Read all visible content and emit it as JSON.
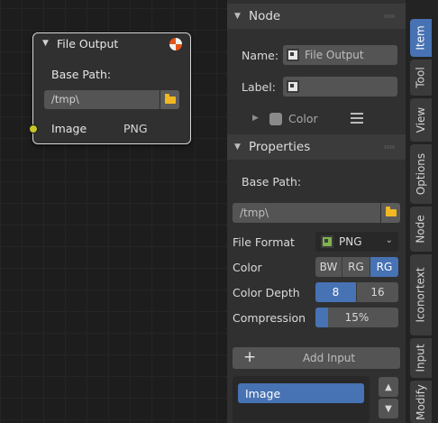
{
  "node": {
    "title": "File Output",
    "base_path_label": "Base Path:",
    "base_path_value": "/tmp\\",
    "input_label": "Image",
    "input_format": "PNG"
  },
  "sidebar": {
    "node_panel": {
      "title": "Node",
      "name_label": "Name:",
      "name_value": "File Output",
      "label_label": "Label:",
      "label_value": "",
      "color_label": "Color"
    },
    "properties_panel": {
      "title": "Properties",
      "base_path_label": "Base Path:",
      "base_path_value": "/tmp\\",
      "file_format_label": "File Format",
      "file_format_value": "PNG",
      "color_label": "Color",
      "color_options": [
        "BW",
        "RG",
        "RG"
      ],
      "color_selected_index": 2,
      "color_depth_label": "Color Depth",
      "color_depth_options": [
        "8",
        "16"
      ],
      "color_depth_selected_index": 0,
      "compression_label": "Compression",
      "compression_value": "15%",
      "compression_fraction": 0.15,
      "add_input_label": "Add Input",
      "inputs": [
        "Image"
      ]
    }
  },
  "tabs": [
    {
      "label": "Item",
      "active": true
    },
    {
      "label": "Tool",
      "active": false
    },
    {
      "label": "View",
      "active": false
    },
    {
      "label": "Options",
      "active": false
    },
    {
      "label": "Node",
      "active": false
    },
    {
      "label": "Iconortext",
      "active": false
    },
    {
      "label": "Input",
      "active": false
    },
    {
      "label": "Modify",
      "active": false
    }
  ],
  "colors": {
    "accent": "#4772b3",
    "socket_yellow": "#c7c729",
    "folder_yellow": "#f1b821"
  }
}
